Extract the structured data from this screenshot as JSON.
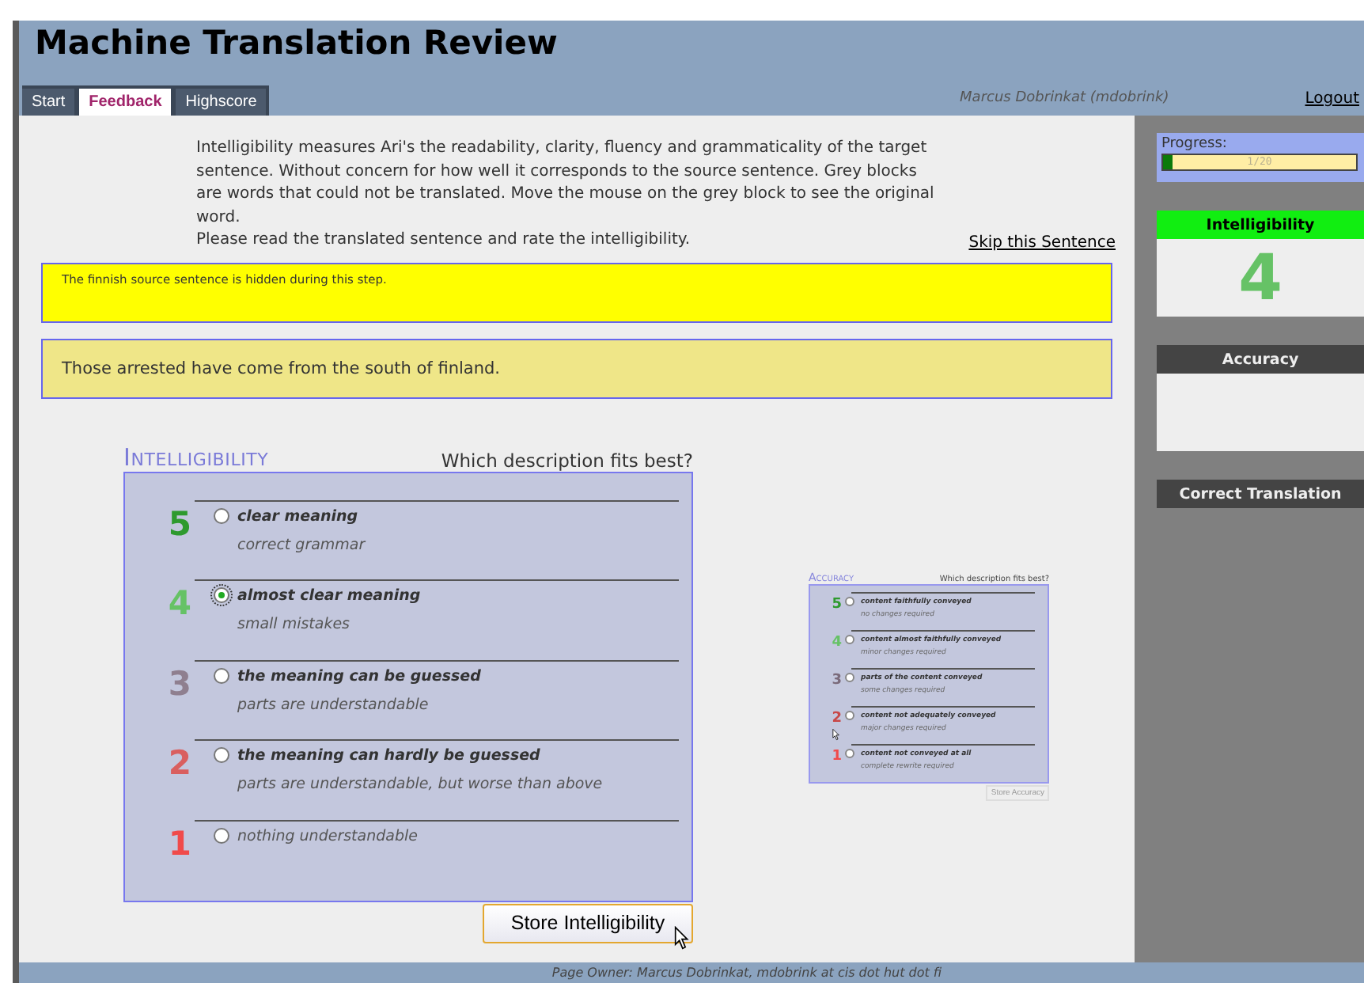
{
  "header": {
    "title": "Machine Translation Review",
    "user": "Marcus Dobrinkat (mdobrink)",
    "logout": "Logout"
  },
  "tabs": [
    {
      "label": "Start",
      "selected": false
    },
    {
      "label": "Feedback",
      "selected": true
    },
    {
      "label": "Highscore",
      "selected": false
    }
  ],
  "instructions": [
    "Intelligibility measures Ari's the readability, clarity, fluency and grammaticality of the target sentence. Without concern for how well it corresponds to the source sentence. Grey blocks are words that could not be translated. Move the mouse on the grey block to see the original word.",
    "Please read the translated sentence and rate the intelligibility."
  ],
  "skip_link": "Skip this Sentence",
  "source_notice": "The finnish source sentence is hidden during this step.",
  "translation": "Those arrested have come from the south of finland.",
  "rating": {
    "title": "INTELLIGIBILITY",
    "question": "Which description fits best?",
    "button": "Store Intelligibility",
    "options": [
      {
        "score": "5",
        "color": "#2e9a2e",
        "label": "clear meaning",
        "detail": "correct grammar",
        "selected": false
      },
      {
        "score": "4",
        "color": "#66c266",
        "label": "almost clear meaning",
        "detail": "small mistakes",
        "selected": true
      },
      {
        "score": "3",
        "color": "#8f7f8f",
        "label": "the meaning can be guessed",
        "detail": "parts are understandable",
        "selected": false
      },
      {
        "score": "2",
        "color": "#d95f5f",
        "label": "the meaning can hardly be guessed",
        "detail": "parts are understandable, but worse than above",
        "selected": false
      },
      {
        "score": "1",
        "color": "#f04a4a",
        "detail": "nothing understandable",
        "selected": false
      }
    ]
  },
  "accuracy_preview": {
    "title": "ACCURACY",
    "question": "Which description fits best?",
    "button": "Store Accuracy",
    "options": [
      {
        "score": "5",
        "color": "#2e9a2e",
        "label": "content faithfully conveyed",
        "detail": "no changes required",
        "selected": false
      },
      {
        "score": "4",
        "color": "#66c266",
        "label": "content almost faithfully conveyed",
        "detail": "minor changes required",
        "selected": false
      },
      {
        "score": "3",
        "color": "#7a6a7a",
        "label": "parts of the content conveyed",
        "detail": "some changes required",
        "selected": false
      },
      {
        "score": "2",
        "color": "#c84848",
        "label": "content not adequately conveyed",
        "detail": "major changes required",
        "selected": false
      },
      {
        "score": "1",
        "color": "#f04a4a",
        "label": "content not conveyed at all",
        "detail": "complete rewrite required",
        "selected": false
      }
    ]
  },
  "sidebar": {
    "progress": {
      "label": "Progress:",
      "level": 0.05,
      "reading": "1/20"
    },
    "panels": [
      {
        "kind": "score",
        "title": "Intelligibility",
        "completed": true,
        "value": "4",
        "color": "#66c266"
      },
      {
        "kind": "score",
        "title": "Accuracy",
        "completed": false
      },
      {
        "kind": "heading",
        "title": "Correct Translation",
        "completed": false
      }
    ]
  },
  "footer": "Page Owner: Marcus Dobrinkat, mdobrink at cis dot hut dot fi"
}
